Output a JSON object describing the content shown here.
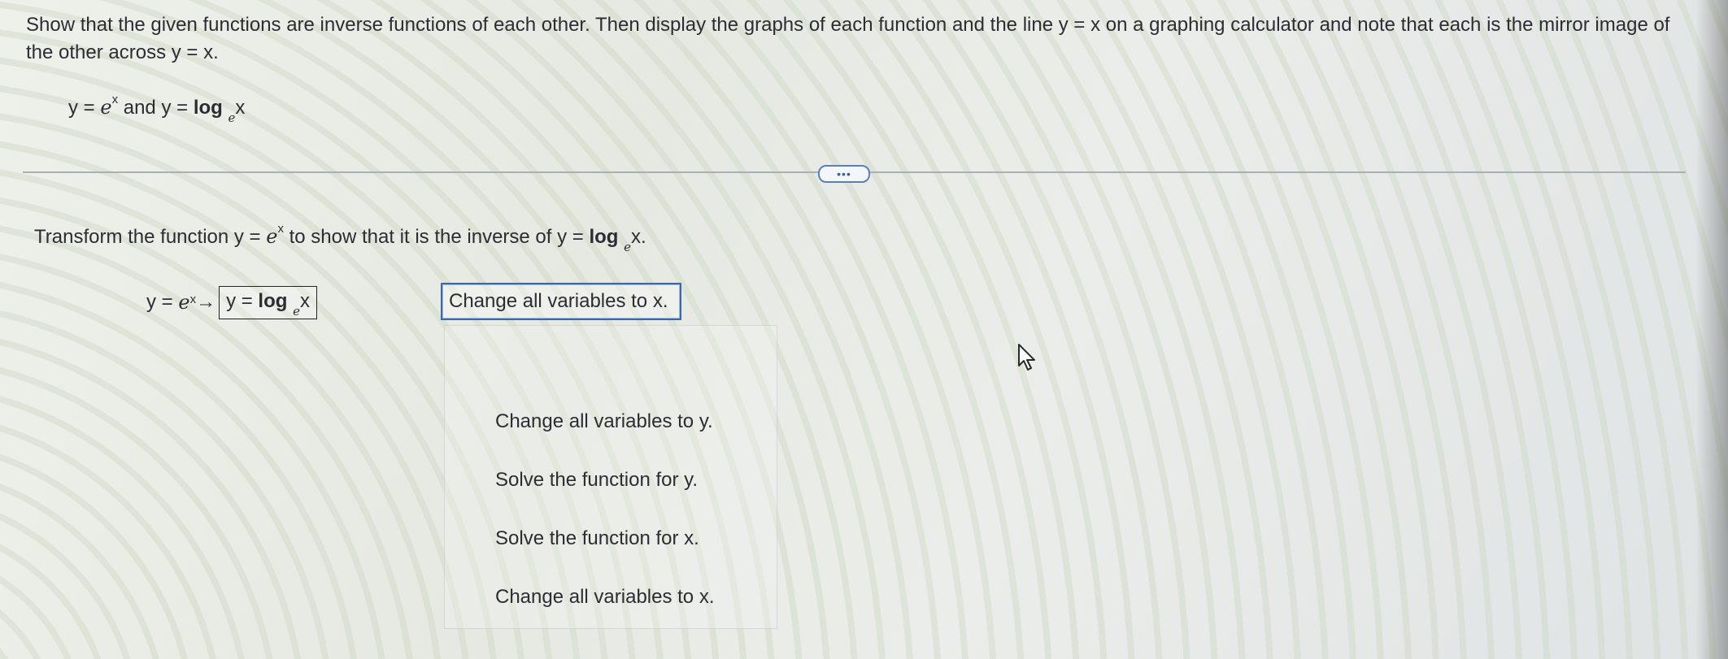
{
  "question": {
    "instructions": "Show that the given functions are inverse functions of each other. Then display the graphs of each function and the line y = x on a graphing calculator and note that each is the mirror image of the other across y = x.",
    "functions": {
      "f_lhs": "y = ",
      "f_base": "e",
      "f_exp": "x",
      "connector": " and ",
      "g_lhs": "y = ",
      "g_log": "log",
      "g_base": "e",
      "g_arg": "x"
    }
  },
  "toolbar": {
    "more_label": "•••"
  },
  "step": {
    "prompt_pre": "Transform the function y = ",
    "prompt_base": "e",
    "prompt_exp": "x",
    "prompt_mid": " to show that it is the inverse of y = ",
    "prompt_log": "log",
    "prompt_log_base": "e",
    "prompt_post": "x."
  },
  "equation": {
    "lhs": "y = ",
    "base": "e",
    "exp": "x",
    "arrow": "→",
    "answer_lhs": "y = ",
    "answer_log": "log",
    "answer_base": "e",
    "answer_arg": "x"
  },
  "select": {
    "selected": "Change all variables to x.",
    "options": [
      "Change all variables to y.",
      "Solve the function for y.",
      "Solve the function for x.",
      "Change all variables to x."
    ]
  }
}
